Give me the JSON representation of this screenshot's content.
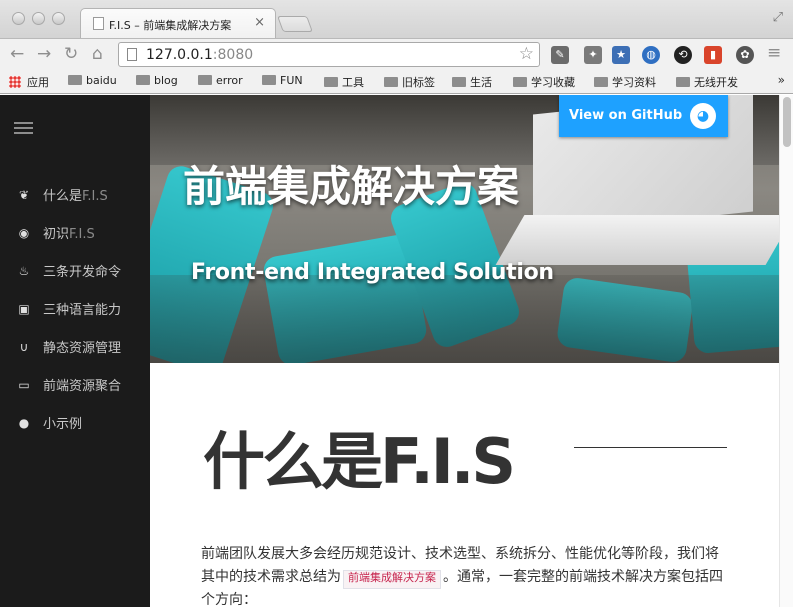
{
  "browser": {
    "tab_title": "F.I.S – 前端集成解决方案",
    "tab_close": "×",
    "url_host": "127.0.0.1",
    "url_port": ":8080",
    "bookmarks": [
      {
        "label": "应用",
        "icon": "apps-grid-icon"
      },
      {
        "label": "baidu",
        "icon": "folder-icon"
      },
      {
        "label": "blog",
        "icon": "folder-icon"
      },
      {
        "label": "error",
        "icon": "folder-icon"
      },
      {
        "label": "FUN",
        "icon": "folder-icon"
      },
      {
        "label": "工具",
        "icon": "folder-icon"
      },
      {
        "label": "旧标签",
        "icon": "folder-icon"
      },
      {
        "label": "生活",
        "icon": "folder-icon"
      },
      {
        "label": "学习收藏",
        "icon": "folder-icon"
      },
      {
        "label": "学习资料",
        "icon": "folder-icon"
      },
      {
        "label": "无线开发",
        "icon": "folder-icon"
      }
    ],
    "bookmarks_more": "»"
  },
  "sidebar": {
    "items": [
      {
        "label": "什么是",
        "label_thin": "F.I.S",
        "icon": "leaf-icon",
        "glyph": "❦"
      },
      {
        "label": "初识",
        "label_thin": "F.I.S",
        "icon": "eye-icon",
        "glyph": "◉"
      },
      {
        "label": "三条开发命令",
        "label_thin": "",
        "icon": "fire-icon",
        "glyph": "♨"
      },
      {
        "label": "三种语言能力",
        "label_thin": "",
        "icon": "gift-icon",
        "glyph": "▣"
      },
      {
        "label": "静态资源管理",
        "label_thin": "",
        "icon": "magnet-icon",
        "glyph": "∪"
      },
      {
        "label": "前端资源聚合",
        "label_thin": "",
        "icon": "inbox-icon",
        "glyph": "▭"
      },
      {
        "label": "小示例",
        "label_thin": "",
        "icon": "tint-icon",
        "glyph": "●"
      }
    ]
  },
  "hero": {
    "title": "前端集成解决方案",
    "subtitle": "Front-end Integrated Solution",
    "github_label": "View on GitHub",
    "github_icon": "github-octocat-icon"
  },
  "content": {
    "section_title": "什么是F.I.S",
    "para_before": "前端团队发展大多会经历规范设计、技术选型、系统拆分、性能优化等阶段，我们将其中的技术需求总结为",
    "para_code": "前端集成解决方案",
    "para_after": "。通常，一套完整的前端技术解决方案包括四个方向："
  },
  "colors": {
    "sidebar_bg": "#1b1b1b",
    "github_button": "#1ea1ff",
    "code_text": "#c7254e"
  }
}
